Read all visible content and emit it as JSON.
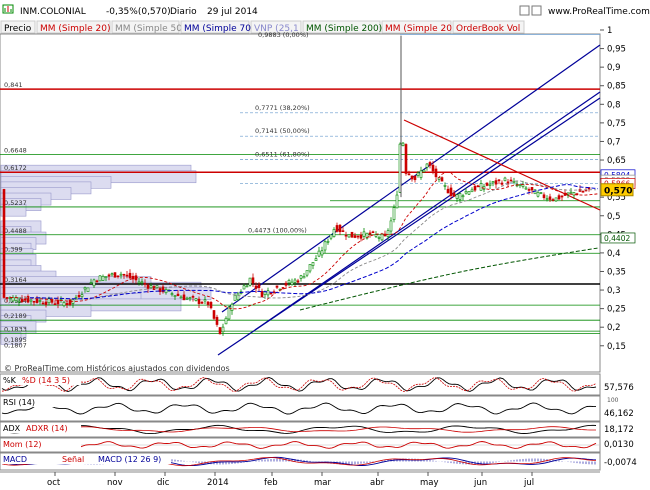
{
  "header": {
    "symbol": "INM.COLONIAL",
    "change": "-0,35%(0,570)",
    "period": "Diario",
    "date": "29 jul 2014",
    "site": "www.ProRealTime.com"
  },
  "toolbar": {
    "tabs": [
      {
        "label": "Precio",
        "color": "#000000"
      },
      {
        "label": "MM (Simple 20)",
        "color": "#cc0000"
      },
      {
        "label": "MM (Simple 50)",
        "color": "#888888"
      },
      {
        "label": "MM (Simple 70)",
        "color": "#000099"
      },
      {
        "label": "VNP (25,1",
        "color": "#8888cc"
      },
      {
        "label": "MM (Simple 200)",
        "color": "#005500"
      },
      {
        "label": "MM (Simple 20)",
        "color": "#cc0000"
      },
      {
        "label": "OrderBook Vol",
        "color": "#cc0000"
      }
    ]
  },
  "price_axis": {
    "ticks": [
      "1",
      "0,95",
      "0,9",
      "0,85",
      "0,8",
      "0,75",
      "0,7",
      "0,65",
      "0,6",
      "0,55",
      "0,5",
      "0,45",
      "0,4",
      "0,35",
      "0,3",
      "0,25",
      "0,2",
      "0,15"
    ],
    "current_price": "0,570",
    "markers": [
      {
        "label": "0,5804",
        "color": "#0000cc"
      },
      {
        "label": "0,5939",
        "color": "#888888"
      },
      {
        "label": "0,5866",
        "color": "#cc0000"
      },
      {
        "label": "0,4402",
        "color": "#005500"
      }
    ]
  },
  "levels": {
    "left": [
      "0,841",
      "0,6648",
      "0,6172",
      "0,5237",
      "0,4488",
      "0,399",
      "0,3164",
      "0,2189",
      "0,1833",
      "0,1895",
      "0,1807",
      "0,2594"
    ],
    "fib": [
      "0,7771 (38,20%)",
      "0,7141 (50,00%)",
      "0,6511 (61,80%)",
      "0,4473 (100,00%)"
    ],
    "top_cut": "0,9883 (0,00%)"
  },
  "watermark": "© ProRealTime.com   Históricos ajustados con dividendos",
  "months": [
    "oct",
    "nov",
    "dic",
    "2014",
    "feb",
    "mar",
    "abr",
    "may",
    "jun",
    "jul"
  ],
  "indicators": [
    {
      "name": "%K",
      "label2": "%D (14 3 5)",
      "value": "57,576",
      "color2": "#cc0000"
    },
    {
      "name": "RSI (14)",
      "value": "46,162",
      "top_value": "100"
    },
    {
      "name": "ADX",
      "label2": "ADXR (14)",
      "value": "18,172",
      "color2": "#cc0000"
    },
    {
      "name": "Mom (12)",
      "value": "0,0130",
      "color": "#cc0000"
    },
    {
      "name": "MACD",
      "label2": "Señal",
      "label3": "MACD (12 26 9)",
      "value": "-0,0074",
      "color": "#000099"
    }
  ],
  "colors": {
    "bull": "#008800",
    "bear": "#cc0000",
    "channel": "#000099",
    "resistance": "#cc0000",
    "support": "#008800"
  }
}
